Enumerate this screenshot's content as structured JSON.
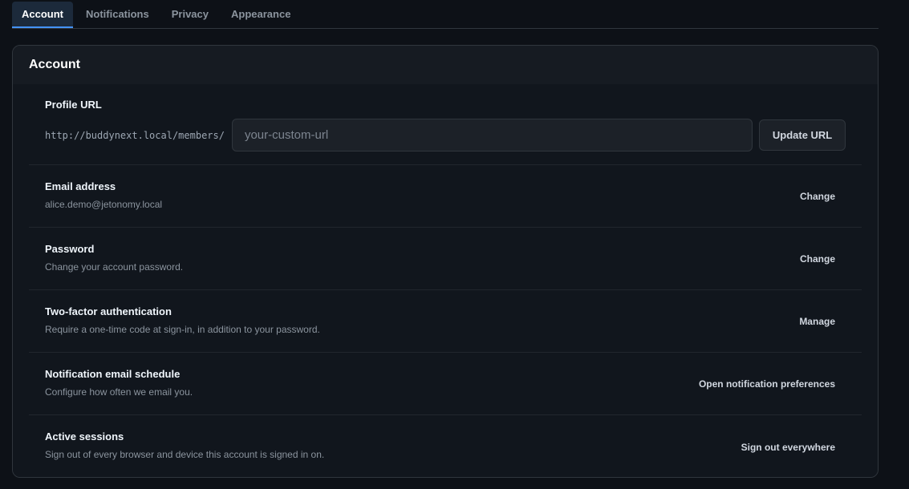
{
  "tabs": [
    {
      "label": "Account",
      "active": true
    },
    {
      "label": "Notifications",
      "active": false
    },
    {
      "label": "Privacy",
      "active": false
    },
    {
      "label": "Appearance",
      "active": false
    }
  ],
  "card": {
    "title": "Account"
  },
  "profile_url": {
    "title": "Profile URL",
    "prefix": "http://buddynext.local/members/",
    "input_value": "",
    "input_placeholder": "your-custom-url",
    "button_label": "Update URL"
  },
  "rows": [
    {
      "title": "Email address",
      "desc": "alice.demo@jetonomy.local",
      "action": "Change"
    },
    {
      "title": "Password",
      "desc": "Change your account password.",
      "action": "Change"
    },
    {
      "title": "Two-factor authentication",
      "desc": "Require a one-time code at sign-in, in addition to your password.",
      "action": "Manage"
    },
    {
      "title": "Notification email schedule",
      "desc": "Configure how often we email you.",
      "action": "Open notification preferences"
    },
    {
      "title": "Active sessions",
      "desc": "Sign out of every browser and device this account is signed in on.",
      "action": "Sign out everywhere"
    }
  ],
  "colors": {
    "background": "#0d1117",
    "card": "#161b22",
    "accent": "#4493f8"
  }
}
